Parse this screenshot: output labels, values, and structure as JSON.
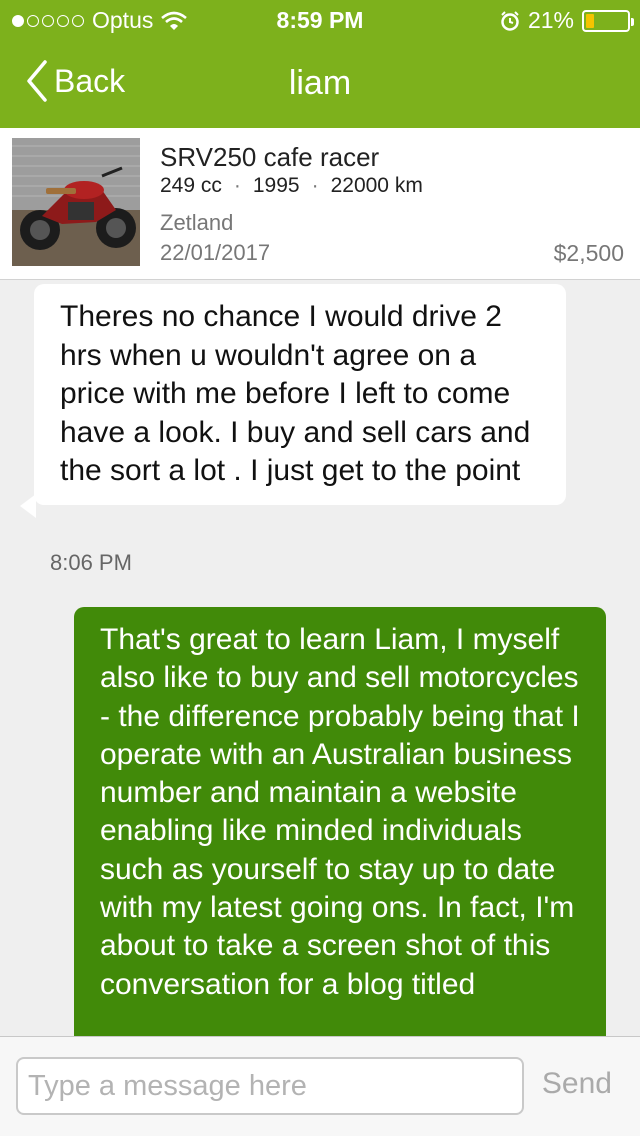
{
  "status_bar": {
    "carrier": "Optus",
    "time": "8:59 PM",
    "battery_percent": "21%",
    "battery_level": 0.21,
    "icons": [
      "signal-dots-icon",
      "wifi-icon",
      "alarm-icon",
      "battery-icon"
    ],
    "signal_strength": 1
  },
  "nav": {
    "back_label": "Back",
    "title": "liam"
  },
  "listing": {
    "title": "SRV250 cafe racer",
    "specs": [
      "249 cc",
      "1995",
      "22000 km"
    ],
    "spec_separator": "·",
    "location": "Zetland",
    "date": "22/01/2017",
    "price": "$2,500"
  },
  "messages": [
    {
      "direction": "incoming",
      "text": "Theres no chance I would drive 2 hrs  when u wouldn't  agree on a price with me before I left to come have a look. I buy and sell cars and the sort a lot . I just get to the point",
      "time": "8:06 PM"
    },
    {
      "direction": "outgoing",
      "text": "That's great to learn Liam, I myself also like to buy and sell motorcycles - the difference probably being that I operate with an Australian business number and maintain a website enabling like minded individuals such as yourself to stay up to date with my latest going ons. In fact, I'm about to take a screen shot of this conversation for a blog titled"
    }
  ],
  "composer": {
    "placeholder": "Type a message here",
    "send_label": "Send"
  },
  "colors": {
    "header": "#7db11c",
    "outgoing_bubble": "#418a09",
    "incoming_bubble": "#ffffff",
    "background": "#efefef"
  }
}
